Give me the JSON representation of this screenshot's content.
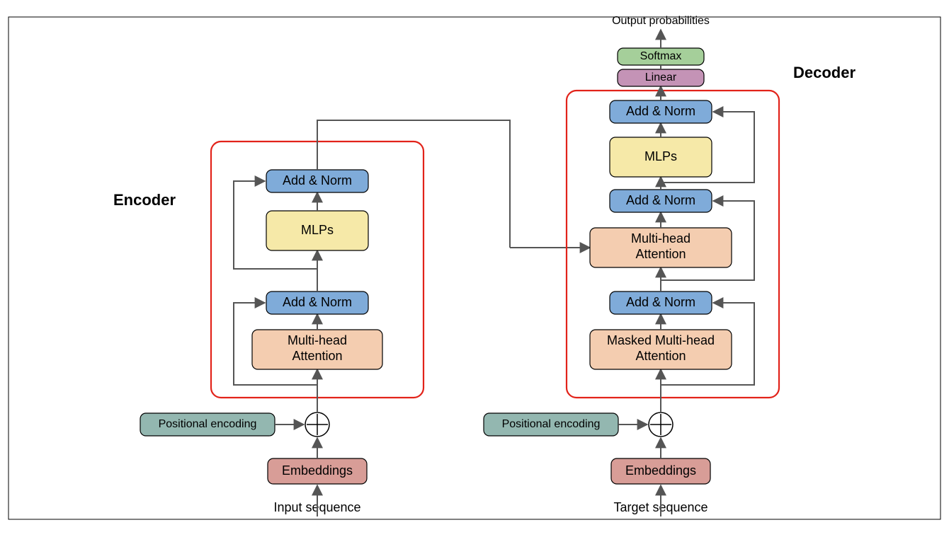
{
  "title": {
    "encoder": "Encoder",
    "decoder": "Decoder"
  },
  "io": {
    "input": "Input sequence",
    "target": "Target sequence",
    "output": "Output probabilities"
  },
  "blocks": {
    "posenc": "Positional encoding",
    "embed": "Embeddings",
    "addnorm": "Add & Norm",
    "mlps": "MLPs",
    "mha": "Multi-head",
    "mha2": "Attention",
    "mmha": "Masked Multi-head",
    "mmha2": "Attention",
    "linear": "Linear",
    "softmax": "Softmax"
  }
}
